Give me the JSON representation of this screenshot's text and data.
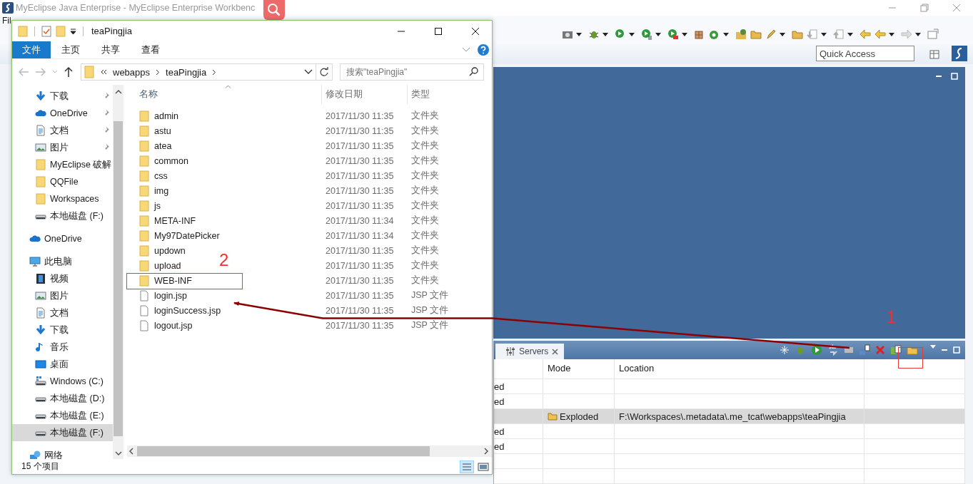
{
  "eclipse": {
    "title": "MyEclipse Java Enterprise - MyEclipse Enterprise Workbenc",
    "menu": [
      "Fil"
    ],
    "quick_access": {
      "placeholder": "Quick Access"
    },
    "servers_view": {
      "tab": "Servers",
      "columns": [
        "Mode",
        "Location"
      ],
      "rows": [
        {
          "column_1": "ed",
          "selected": false
        },
        {
          "column_1": "ed",
          "selected": false
        },
        {
          "mode": "Exploded",
          "location": "F:\\Workspaces\\.metadata\\.me_tcat\\webapps\\teaPingjia",
          "selected": true
        },
        {
          "column_1": "ed",
          "selected": false
        },
        {
          "column_1": "ed",
          "selected": false
        }
      ]
    }
  },
  "explorer": {
    "title": "teaPingjia",
    "ribbon_tabs": [
      {
        "label": "文件",
        "selected": true
      },
      {
        "label": "主页",
        "selected": false
      },
      {
        "label": "共享",
        "selected": false
      },
      {
        "label": "查看",
        "selected": false
      }
    ],
    "breadcrumb": [
      "webapps",
      "teaPingjia"
    ],
    "search": {
      "placeholder": "搜索\"teaPingjia\""
    },
    "sidebar": {
      "quick_access": [
        {
          "label": "下载",
          "kind": "download",
          "pinned": true,
          "selected": false
        },
        {
          "label": "OneDrive",
          "kind": "cloud",
          "pinned": true,
          "selected": false
        },
        {
          "label": "文档",
          "kind": "document",
          "pinned": true,
          "selected": false
        },
        {
          "label": "图片",
          "kind": "picture",
          "pinned": true,
          "selected": false
        },
        {
          "label": "MyEclipse 破解",
          "kind": "folder",
          "pinned": false,
          "selected": false
        },
        {
          "label": "QQFile",
          "kind": "folder",
          "pinned": false,
          "selected": false
        },
        {
          "label": "Workspaces",
          "kind": "folder",
          "pinned": false,
          "selected": false
        },
        {
          "label": "本地磁盘 (F:)",
          "kind": "drive",
          "pinned": false,
          "selected": false
        }
      ],
      "locations": [
        {
          "label": "OneDrive",
          "kind": "cloud",
          "selected": false
        },
        {
          "label": "此电脑",
          "kind": "computer",
          "selected": false,
          "children": [
            {
              "label": "视频",
              "kind": "video",
              "selected": false
            },
            {
              "label": "图片",
              "kind": "picture",
              "selected": false
            },
            {
              "label": "文档",
              "kind": "document",
              "selected": false
            },
            {
              "label": "下载",
              "kind": "download",
              "selected": false
            },
            {
              "label": "音乐",
              "kind": "music",
              "selected": false
            },
            {
              "label": "桌面",
              "kind": "desktop",
              "selected": false
            },
            {
              "label": "Windows (C:)",
              "kind": "windows-drive",
              "selected": false
            },
            {
              "label": "本地磁盘 (D:)",
              "kind": "drive",
              "selected": false
            },
            {
              "label": "本地磁盘 (E:)",
              "kind": "drive",
              "selected": false
            },
            {
              "label": "本地磁盘 (F:)",
              "kind": "drive",
              "selected": true
            }
          ]
        },
        {
          "label": "网络",
          "kind": "network",
          "selected": false
        }
      ]
    },
    "columns": [
      "名称",
      "修改日期",
      "类型"
    ],
    "files": [
      {
        "kind": "folder",
        "name": "admin",
        "modified": "2017/11/30 11:35",
        "type": "文件夹"
      },
      {
        "kind": "folder",
        "name": "astu",
        "modified": "2017/11/30 11:35",
        "type": "文件夹"
      },
      {
        "kind": "folder",
        "name": "atea",
        "modified": "2017/11/30 11:35",
        "type": "文件夹"
      },
      {
        "kind": "folder",
        "name": "common",
        "modified": "2017/11/30 11:35",
        "type": "文件夹"
      },
      {
        "kind": "folder",
        "name": "css",
        "modified": "2017/11/30 11:35",
        "type": "文件夹"
      },
      {
        "kind": "folder",
        "name": "img",
        "modified": "2017/11/30 11:35",
        "type": "文件夹"
      },
      {
        "kind": "folder",
        "name": "js",
        "modified": "2017/11/30 11:35",
        "type": "文件夹"
      },
      {
        "kind": "folder",
        "name": "META-INF",
        "modified": "2017/11/30 11:34",
        "type": "文件夹"
      },
      {
        "kind": "folder",
        "name": "My97DatePicker",
        "modified": "2017/11/30 11:34",
        "type": "文件夹"
      },
      {
        "kind": "folder",
        "name": "updown",
        "modified": "2017/11/30 11:35",
        "type": "文件夹"
      },
      {
        "kind": "folder",
        "name": "upload",
        "modified": "2017/11/30 11:35",
        "type": "文件夹"
      },
      {
        "kind": "folder",
        "name": "WEB-INF",
        "modified": "2017/11/30 11:35",
        "type": "文件夹"
      },
      {
        "kind": "file",
        "name": "login.jsp",
        "modified": "2017/11/30 11:35",
        "type": "JSP 文件"
      },
      {
        "kind": "file",
        "name": "loginSuccess.jsp",
        "modified": "2017/11/30 11:35",
        "type": "JSP 文件"
      },
      {
        "kind": "file",
        "name": "logout.jsp",
        "modified": "2017/11/30 11:35",
        "type": "JSP 文件"
      }
    ],
    "status": "15 个项目"
  },
  "annotations": [
    {
      "label": "2"
    },
    {
      "label": "1"
    }
  ]
}
